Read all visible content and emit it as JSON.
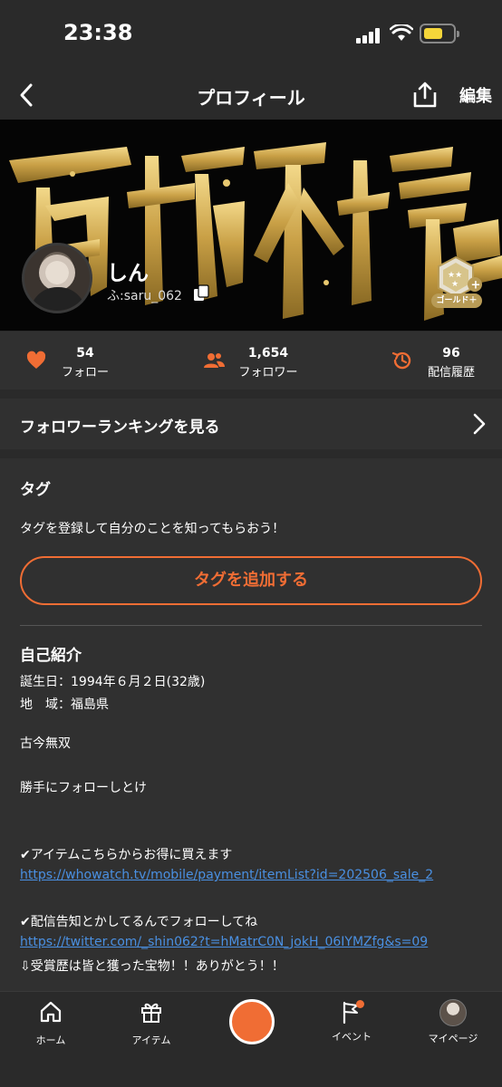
{
  "status_bar": {
    "time": "23:38"
  },
  "header": {
    "title": "プロフィール",
    "edit_label": "編集"
  },
  "profile": {
    "name": "しん",
    "user_id": "ふ:saru_062",
    "rank_badge": "ゴールド＋"
  },
  "stats": [
    {
      "value": "54",
      "label": "フォロー",
      "icon": "heart-icon"
    },
    {
      "value": "1,654",
      "label": "フォロワー",
      "icon": "users-icon"
    },
    {
      "value": "96",
      "label": "配信履歴",
      "icon": "history-icon"
    }
  ],
  "ranking": {
    "label": "フォロワーランキングを見る"
  },
  "tags": {
    "title": "タグ",
    "description": "タグを登録して自分のことを知ってもらおう！",
    "add_button": "タグを追加する"
  },
  "intro": {
    "title": "自己紹介",
    "birthday": "誕生日：1994年６月２日(32歳)",
    "region": "地　域：福島県",
    "line1": "古今無双",
    "line2": "勝手にフォローしとけ",
    "item_note": "✔アイテムこちらからお得に買えます",
    "item_link": "https://whowatch.tv/mobile/payment/itemList?id=202506_sale_2",
    "stream_note": "✔配信告知とかしてるんでフォローしてね",
    "twitter_link": "https://twitter.com/_shin062?t=hMatrC0N_jokH_06IYMZfg&s=09",
    "award_note": "⇩受賞歴は皆と獲った宝物！！ありがとう！！"
  },
  "bottom_nav": [
    {
      "label": "ホーム",
      "icon": "home-icon"
    },
    {
      "label": "アイテム",
      "icon": "gift-icon"
    },
    {
      "label": "",
      "icon": "live-button"
    },
    {
      "label": "イベント",
      "icon": "flag-icon"
    },
    {
      "label": "マイページ",
      "icon": "avatar-icon"
    }
  ],
  "colors": {
    "accent": "#f06d34",
    "link": "#4a90e2",
    "background": "#2a2a2a",
    "card": "#303030"
  }
}
